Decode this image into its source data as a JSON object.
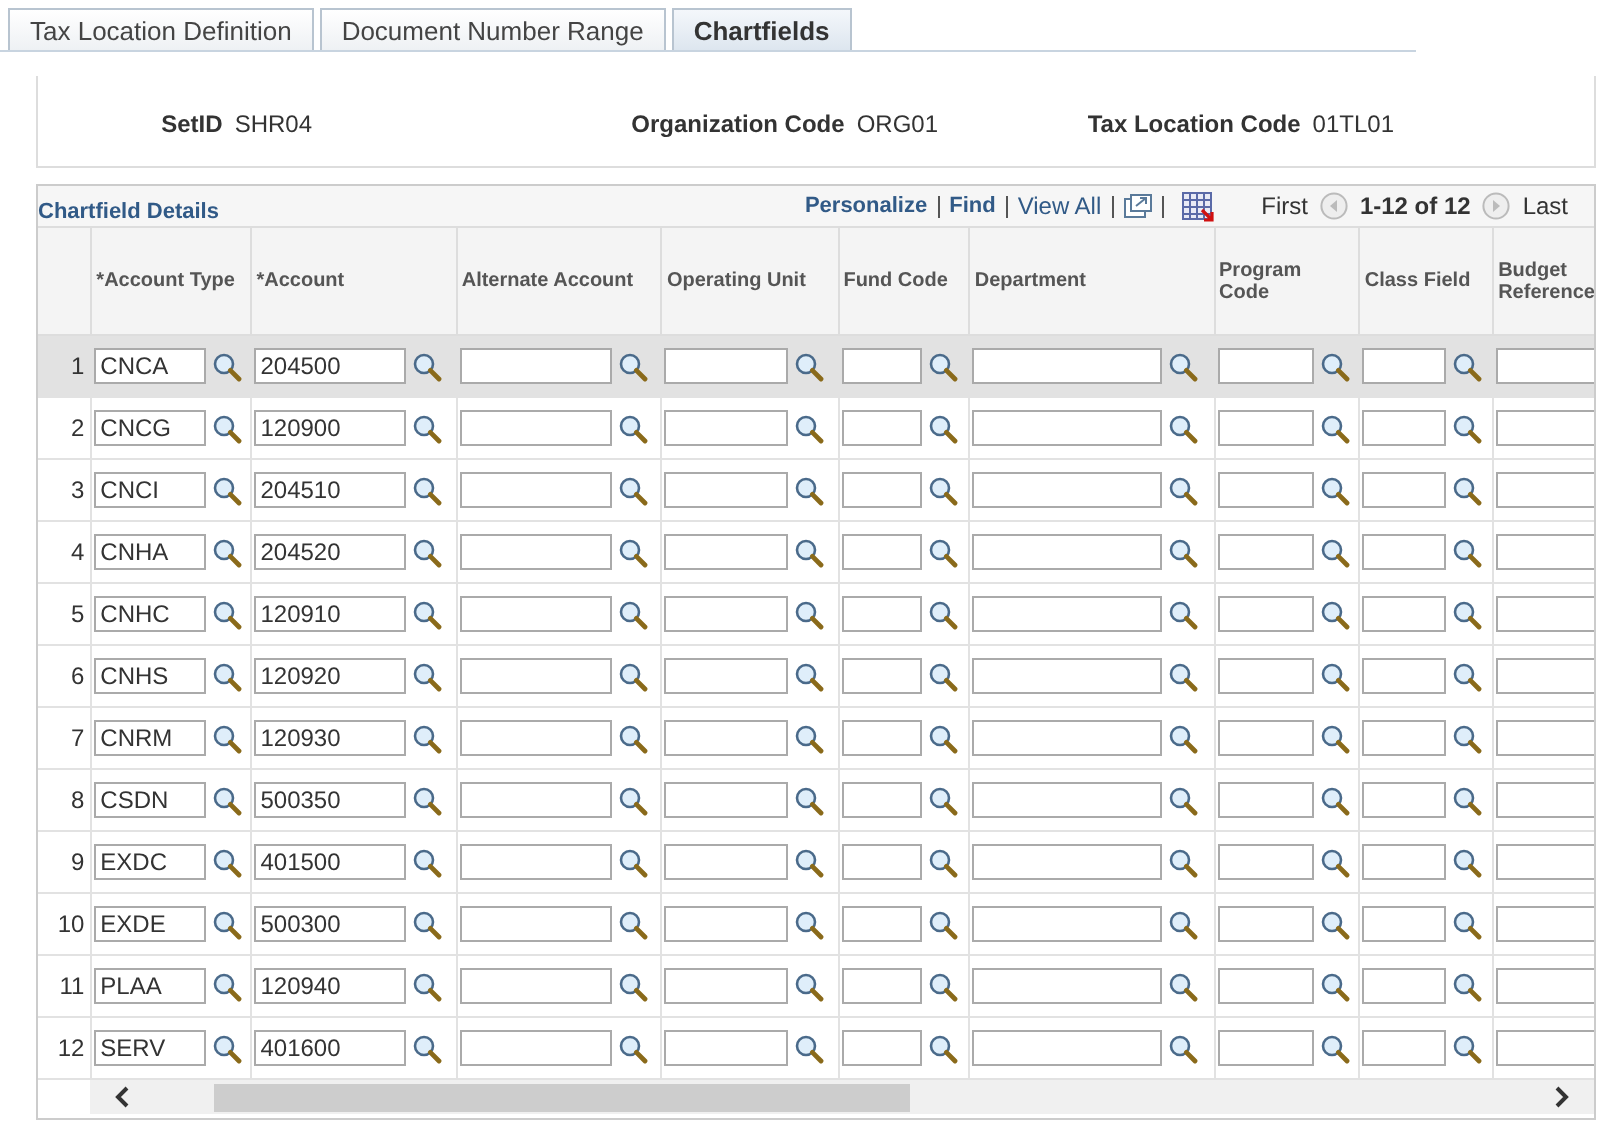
{
  "tabs": [
    {
      "label": "Tax Location Definition",
      "selected": false
    },
    {
      "label": "Document Number Range",
      "selected": false
    },
    {
      "label": "Chartfields",
      "selected": true
    }
  ],
  "header_fields": [
    {
      "label": "SetID",
      "value": "SHR04"
    },
    {
      "label": "Organization Code",
      "value": "ORG01"
    },
    {
      "label": "Tax Location Code",
      "value": "01TL01"
    }
  ],
  "grid": {
    "title": "Chartfield Details",
    "toolbar_links": [
      "Personalize",
      "Find",
      "View All"
    ],
    "navigation": {
      "first": "First",
      "range": "1-12 of 12",
      "last": "Last"
    },
    "columns": [
      "*Account Type",
      "*Account",
      "Alternate Account",
      "Operating Unit",
      "Fund Code",
      "Department",
      "Program Code",
      "Class Field",
      "Budget Reference"
    ],
    "rows": [
      {
        "number": "1",
        "account_type": "CNCA",
        "account": "204500",
        "selected": true
      },
      {
        "number": "2",
        "account_type": "CNCG",
        "account": "120900",
        "selected": false
      },
      {
        "number": "3",
        "account_type": "CNCI",
        "account": "204510",
        "selected": false
      },
      {
        "number": "4",
        "account_type": "CNHA",
        "account": "204520",
        "selected": false
      },
      {
        "number": "5",
        "account_type": "CNHC",
        "account": "120910",
        "selected": false
      },
      {
        "number": "6",
        "account_type": "CNHS",
        "account": "120920",
        "selected": false
      },
      {
        "number": "7",
        "account_type": "CNRM",
        "account": "120930",
        "selected": false
      },
      {
        "number": "8",
        "account_type": "CSDN",
        "account": "500350",
        "selected": false
      },
      {
        "number": "9",
        "account_type": "EXDC",
        "account": "401500",
        "selected": false
      },
      {
        "number": "10",
        "account_type": "EXDE",
        "account": "500300",
        "selected": false
      },
      {
        "number": "11",
        "account_type": "PLAA",
        "account": "120940",
        "selected": false
      },
      {
        "number": "12",
        "account_type": "SERV",
        "account": "401600",
        "selected": false
      }
    ]
  }
}
